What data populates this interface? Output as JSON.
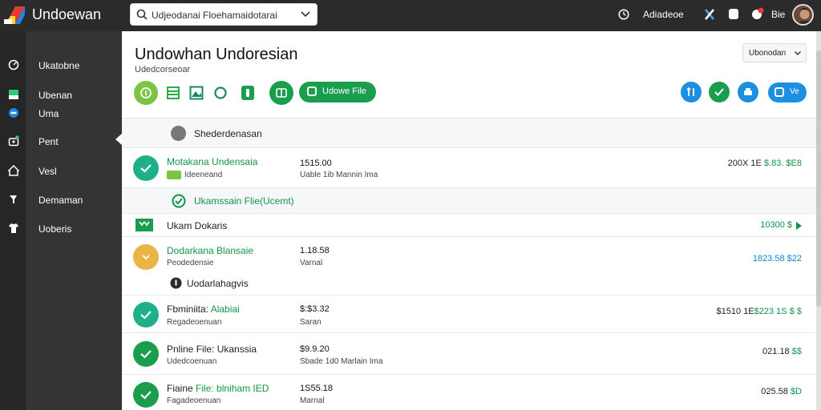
{
  "app": {
    "brand": "Undoewan",
    "search_value": "Udjeodanai Floehamaidotarai",
    "top_label": "Adiadeoe",
    "top_user": "Bie"
  },
  "sidebar": {
    "items": [
      {
        "label": "Ukatobne",
        "icon": "gauge-icon"
      },
      {
        "label": "Ubenan",
        "icon": "flag-icon"
      },
      {
        "label": "Uma",
        "icon": "toggle-icon"
      },
      {
        "label": "Pent",
        "icon": "briefcase-icon"
      },
      {
        "label": "Vesl",
        "icon": "home-icon"
      },
      {
        "label": "Demaman",
        "icon": "pin-icon"
      },
      {
        "label": "Uoberis",
        "icon": "shirt-icon"
      }
    ]
  },
  "page": {
    "title": "Undowhan Undoresian",
    "subtitle": "Udedcorseoar",
    "sort_label": "Ubonodan",
    "action_pill": "Udowe File",
    "action_pill_right": "Ve"
  },
  "group": {
    "label": "Shederdenasan"
  },
  "rows": [
    {
      "name": "Motakana Undensaia",
      "meta": "Ideeneand",
      "amount": "1515.00",
      "sub": "Uable 1ib  Mannin Ima",
      "right_dark": "200X 1E",
      "right_colored": "$.83. $E8",
      "variant": "check-teal"
    },
    {
      "name": "Ukamssain Flie(Ucemt)",
      "variant": "subgroup"
    },
    {
      "name": "Ukam Dokaris",
      "right_colored": "10300 $",
      "variant": "tag-green"
    },
    {
      "name": "Dodarkana Blansaie",
      "meta": "Peodedensie",
      "amount": "1.18.58",
      "sub": "Varnal",
      "right_colored": "1823.58 $22",
      "variant": "dot-amber"
    },
    {
      "name": "Uodarlahagvis",
      "variant": "subheader"
    },
    {
      "name": "Fbminiita:",
      "name_colored": "Alabiai",
      "meta": "Regadeoenuan",
      "amount": "$:$3.32",
      "sub": "Saran",
      "right_dark": "$1510 1E",
      "right_colored": "$223 1S $ $",
      "variant": "check-teal"
    },
    {
      "name": "Pnline File: Ukanssia",
      "meta": "Udedcoenuan",
      "amount": "$9.9.20",
      "sub": "Sbade 1d0  Marlain Ima",
      "right_dark": "021.18",
      "right_colored": "$$",
      "variant": "check-green"
    },
    {
      "name": "Fiaine",
      "name_colored": "File: blniham IED",
      "meta": "Fagadeoenuan",
      "amount": "1S55.18",
      "sub": "Marnal",
      "right_dark": "025.58",
      "right_colored": "$D",
      "variant": "check-green"
    }
  ],
  "colors": {
    "topbar": "#2b2b2b",
    "sidebar": "#343434",
    "accent_green": "#1a9e4e",
    "accent_teal": "#1fb08a",
    "accent_blue": "#1d8fe0",
    "accent_amber": "#e9b544"
  }
}
